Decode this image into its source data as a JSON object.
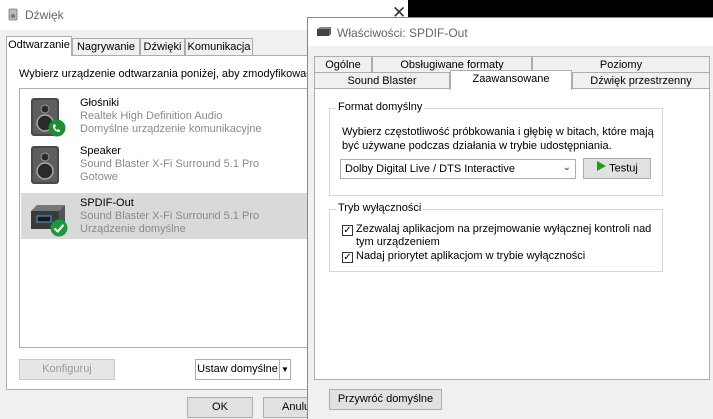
{
  "sound": {
    "title": "Dźwięk",
    "tabs": [
      "Odtwarzanie",
      "Nagrywanie",
      "Dźwięki",
      "Komunikacja"
    ],
    "instruction": "Wybierz urządzenie odtwarzania poniżej, aby zmodyfikować",
    "devices": [
      {
        "name": "Głośniki",
        "line1": "Realtek High Definition Audio",
        "line2": "Domyślne urządzenie komunikacyjne",
        "icon": "speaker-icon",
        "badge": "phone-badge-icon"
      },
      {
        "name": "Speaker",
        "line1": "Sound Blaster X-Fi Surround 5.1 Pro",
        "line2": "Gotowe",
        "icon": "speaker-icon",
        "badge": ""
      },
      {
        "name": "SPDIF-Out",
        "line1": "Sound Blaster X-Fi Surround 5.1 Pro",
        "line2": "Urządzenie domyślne",
        "icon": "digital-output-icon",
        "badge": "check-badge-icon"
      }
    ],
    "configure_label": "Konfiguruj",
    "set_default_label": "Ustaw domyślne",
    "ok_label": "OK",
    "cancel_label": "Anulu"
  },
  "props": {
    "title": "Właściwości: SPDIF-Out",
    "tabs_row1": [
      "Ogólne",
      "Obsługiwane formaty",
      "Poziomy"
    ],
    "tabs_row2": [
      "Sound Blaster",
      "Zaawansowane",
      "Dźwięk przestrzenny"
    ],
    "default_format": {
      "legend": "Format domyślny",
      "description": "Wybierz częstotliwość próbkowania i głębię w bitach, które mają być używane podczas działania w trybie udostępniania.",
      "selected": "Dolby Digital Live / DTS Interactive",
      "test_label": "Testuj"
    },
    "exclusive": {
      "legend": "Tryb wyłączności",
      "option1": "Zezwalaj aplikacjom na przejmowanie wyłącznej kontroli nad tym urządzeniem",
      "option1_checked": true,
      "option2": "Nadaj priorytet aplikacjom w trybie wyłączności",
      "option2_checked": true
    },
    "restore_label": "Przywróć domyślne"
  },
  "colors": {
    "check_green": "#1a9a3a",
    "play_green": "#1aa01a",
    "phone_green": "#1c8f2e"
  }
}
